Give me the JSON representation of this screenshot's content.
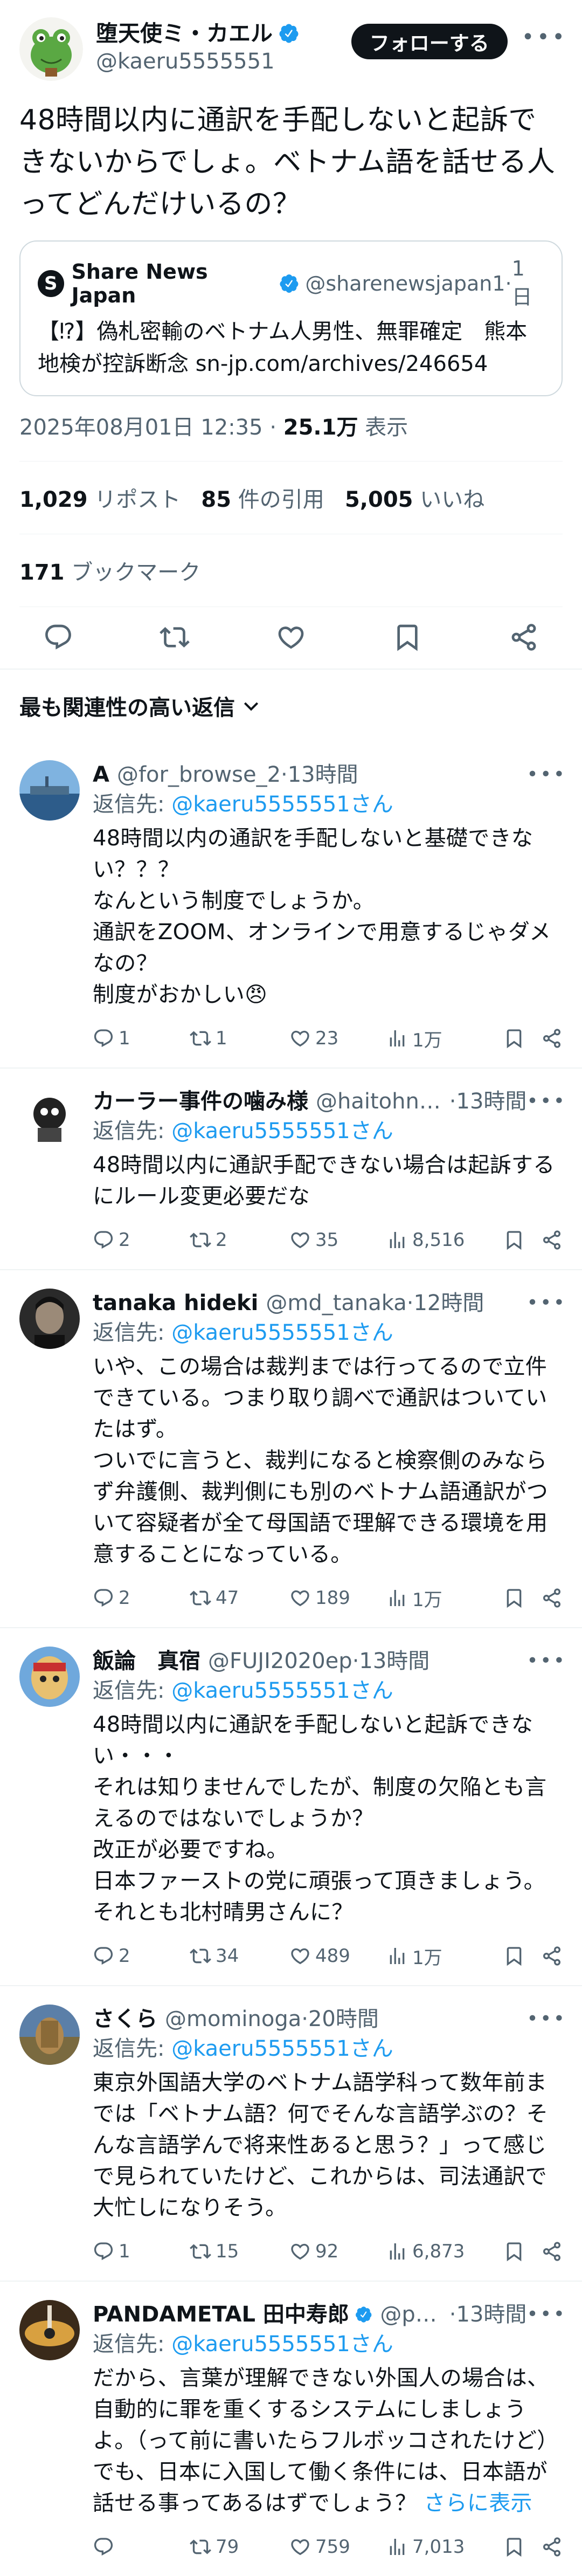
{
  "main_tweet": {
    "display_name": "堕天使ミ・カエル",
    "handle": "@kaeru5555551",
    "follow_label": "フォローする",
    "text": "48時間以内に通訳を手配しないと起訴できないからでしょ。ベトナム語を話せる人ってどんだけいるの？",
    "quote": {
      "name": "Share News Japan",
      "handle": "@sharenewsjapan1",
      "time": "1日",
      "text": "【⁉】偽札密輸のベトナム人男性、無罪確定　熊本地検が控訴断念 sn-jp.com/archives/246654"
    },
    "timestamp": "2025年08月01日 12:35",
    "views_count": "25.1万",
    "views_label": "表示",
    "reposts_count": "1,029",
    "reposts_label": "リポスト",
    "quotes_count": "85",
    "quotes_label": "件の引用",
    "likes_count": "5,005",
    "likes_label": "いいね",
    "bookmarks_count": "171",
    "bookmarks_label": "ブックマーク"
  },
  "sort_label": "最も関連性の高い返信",
  "replies": [
    {
      "name": "A",
      "handle": "@for_browse_2",
      "time": "13時間",
      "reply_to_prefix": "返信先: ",
      "reply_to": "@kaeru5555551さん",
      "text": "48時間以内の通訳を手配しないと基礎できない？？？\nなんという制度でしょうか。\n通訳をZOOM、オンラインで用意するじゃダメなの？\n制度がおかしい😠",
      "more": "",
      "replies": "1",
      "reposts": "1",
      "likes": "23",
      "views": "1万"
    },
    {
      "name": "カーラー事件の噛み様",
      "handle": "@haitohns...",
      "time": "13時間",
      "reply_to_prefix": "返信先: ",
      "reply_to": "@kaeru5555551さん",
      "text": "48時間以内に通訳手配できない場合は起訴するにルール変更必要だな",
      "more": "",
      "replies": "2",
      "reposts": "2",
      "likes": "35",
      "views": "8,516"
    },
    {
      "name": "tanaka hideki",
      "handle": "@md_tanaka",
      "time": "12時間",
      "reply_to_prefix": "返信先: ",
      "reply_to": "@kaeru5555551さん",
      "text": "いや、この場合は裁判までは行ってるので立件できている。つまり取り調べで通訳はついていたはず。\nついでに言うと、裁判になると検察側のみならず弁護側、裁判側にも別のベトナム語通訳がついて容疑者が全て母国語で理解できる環境を用意することになっている。",
      "more": "",
      "replies": "2",
      "reposts": "47",
      "likes": "189",
      "views": "1万"
    },
    {
      "name": "飯論　真宿",
      "handle": "@FUJI2020ep",
      "time": "13時間",
      "reply_to_prefix": "返信先: ",
      "reply_to": "@kaeru5555551さん",
      "text": "48時間以内に通訳を手配しないと起訴できない・・・\nそれは知りませんでしたが、制度の欠陥とも言えるのではないでしょうか？\n改正が必要ですね。\n日本ファーストの党に頑張って頂きましょう。\nそれとも北村晴男さんに？",
      "more": "",
      "replies": "2",
      "reposts": "34",
      "likes": "489",
      "views": "1万"
    },
    {
      "name": "さくら",
      "handle": "@mominoga",
      "time": "20時間",
      "reply_to_prefix": "返信先: ",
      "reply_to": "@kaeru5555551さん",
      "text": "東京外国語大学のベトナム語学科って数年前までは「ベトナム語？何でそんな言語学ぶの？そんな言語学んで将来性あると思う？」って感じで見られていたけど、これからは、司法通訳で大忙しになりそう。",
      "more": "",
      "replies": "1",
      "reposts": "15",
      "likes": "92",
      "views": "6,873"
    },
    {
      "name": "PANDAMETAL 田中寿郎",
      "handle": "@pan...",
      "time": "13時間",
      "reply_to_prefix": "返信先: ",
      "reply_to": "@kaeru5555551さん",
      "text": "だから、言葉が理解できない外国人の場合は、自動的に罪を重くするシステムにしましょうよ。（って前に書いたらフルボッコされたけど）\nでも、日本に入国して働く条件には、日本語が話せる事ってあるはずでしょう？",
      "more": "さらに表示",
      "replies": "",
      "reposts": "79",
      "likes": "759",
      "views": "7,013"
    }
  ],
  "colors": {
    "accent": "#1d9bf0",
    "text": "#0f1419",
    "muted": "#536471",
    "border": "#eff3f4"
  },
  "icons": [
    "reply-icon",
    "repost-icon",
    "like-icon",
    "bookmark-icon",
    "share-icon",
    "views-icon",
    "verified-badge-icon",
    "more-icon",
    "chevron-down-icon"
  ]
}
